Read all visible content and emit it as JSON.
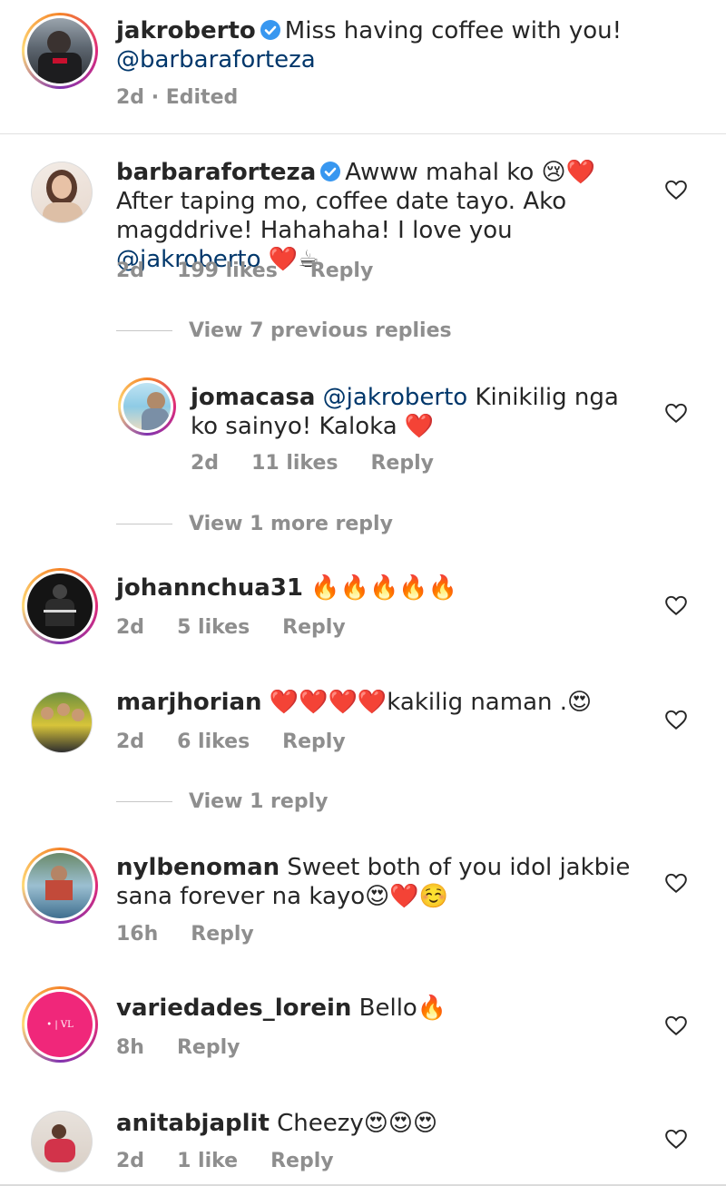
{
  "caption": {
    "username": "jakroberto",
    "text": "Miss having coffee with you!",
    "mention": "@barbaraforteza",
    "meta": "2d · Edited"
  },
  "comments": [
    {
      "username": "barbaraforteza",
      "text_a": "Awww mahal ko 😢❤️ After taping mo, coffee date tayo. Ako magddrive! Hahahaha! I love you ",
      "mention": "@jakroberto",
      "text_b": " ❤️☕",
      "time": "2d",
      "likes": "199 likes",
      "reply": "Reply"
    },
    {
      "view_previous": "View 7 previous replies"
    },
    {
      "username": "jomacasa",
      "mention": "@jakroberto",
      "text_b": " Kinikilig nga ko sainyo! Kaloka ❤️",
      "time": "2d",
      "likes": "11 likes",
      "reply": "Reply"
    },
    {
      "view_more": "View 1 more reply"
    },
    {
      "username": "johannchua31",
      "text": " 🔥🔥🔥🔥🔥",
      "time": "2d",
      "likes": "5 likes",
      "reply": "Reply"
    },
    {
      "username": "marjhorian",
      "text": " ❤️❤️❤️❤️kakilig naman .😍",
      "time": "2d",
      "likes": "6 likes",
      "reply": "Reply"
    },
    {
      "view_reply": "View 1 reply"
    },
    {
      "username": "nylbenoman",
      "text": " Sweet both of you idol jakbie sana forever na kayo😍❤️☺️",
      "time": "16h",
      "reply": "Reply"
    },
    {
      "username": "variedades_lorein",
      "text": " Bello🔥",
      "time": "8h",
      "reply": "Reply"
    },
    {
      "username": "anitabjaplit",
      "text": " Cheezy😍😍😍",
      "time": "2d",
      "likes": "1 like",
      "reply": "Reply"
    }
  ],
  "colors": {
    "verified": "#3897f0",
    "mention": "#00376b",
    "meta": "#8e8e8e",
    "text": "#262626"
  },
  "icons": [
    "verified-badge-icon",
    "heart-outline-icon"
  ]
}
